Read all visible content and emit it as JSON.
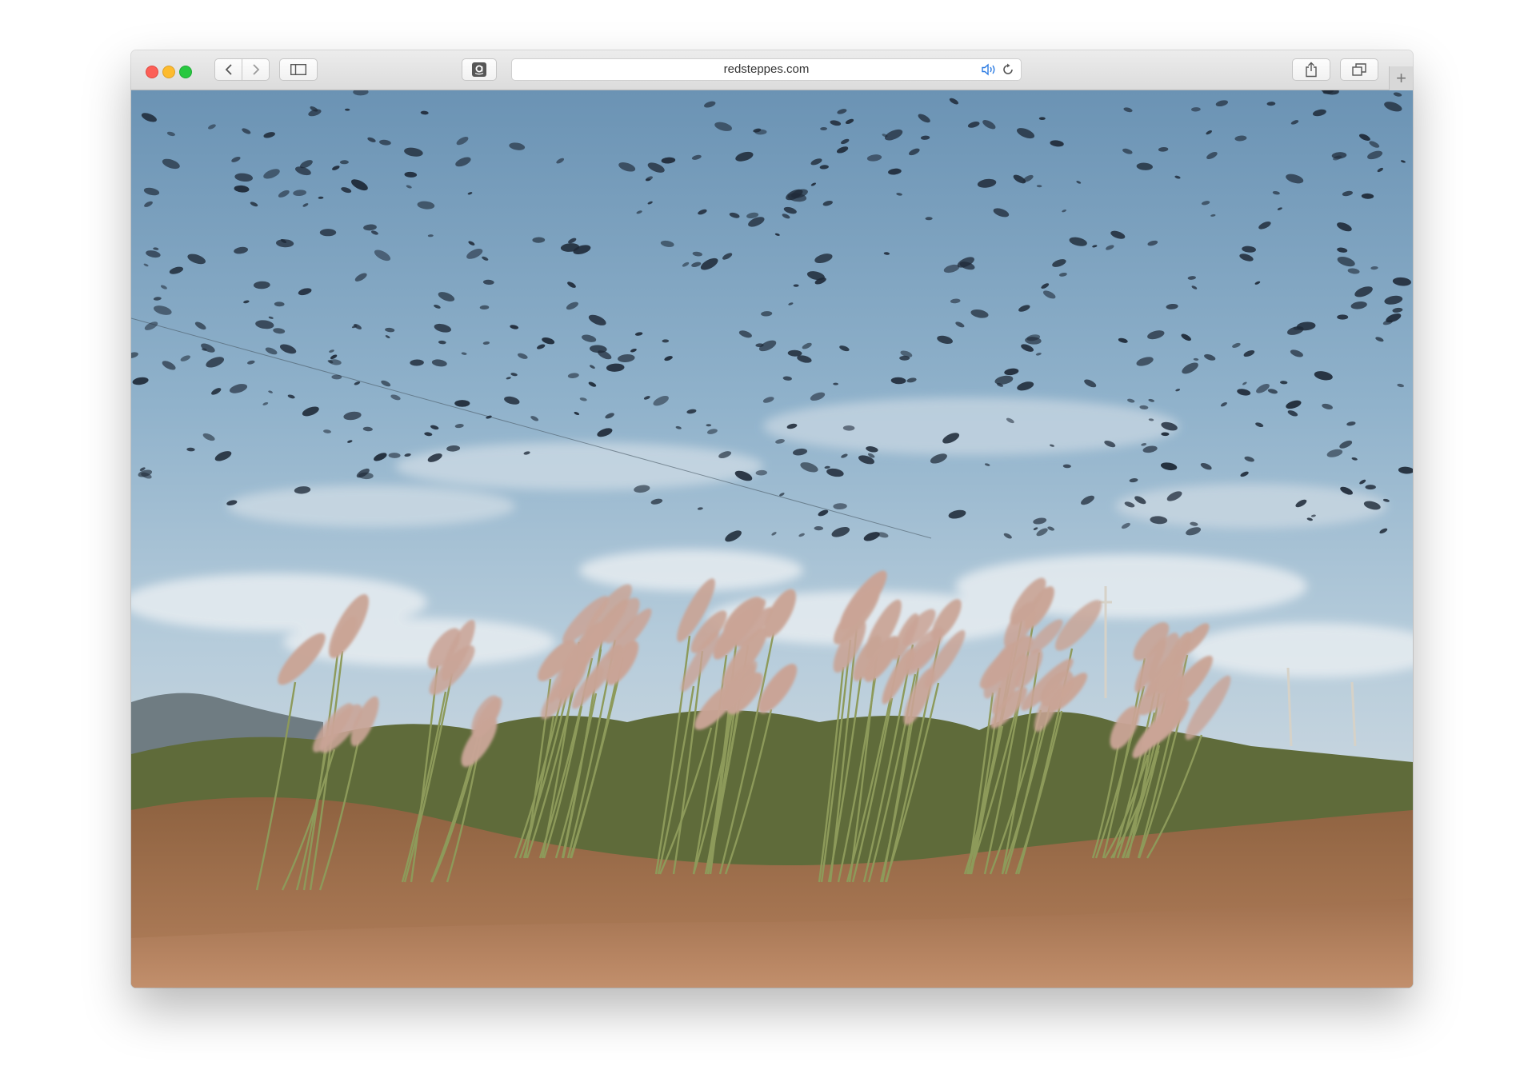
{
  "browser": {
    "url": "redsteppes.com",
    "new_tab_label": "+",
    "icons": {
      "back": "chevron-left-icon",
      "forward": "chevron-right-icon",
      "sidebar": "sidebar-icon",
      "favorite": "amazon-icon",
      "audio": "speaker-icon",
      "reload": "reload-icon",
      "share": "share-icon",
      "tabs": "tabs-icon"
    },
    "colors": {
      "close": "#fc5f57",
      "minimize": "#fdbb2e",
      "zoom": "#28c840",
      "accent": "#2a7ae2"
    }
  },
  "page": {
    "image_subject": "flock of birds over pampas grass"
  }
}
